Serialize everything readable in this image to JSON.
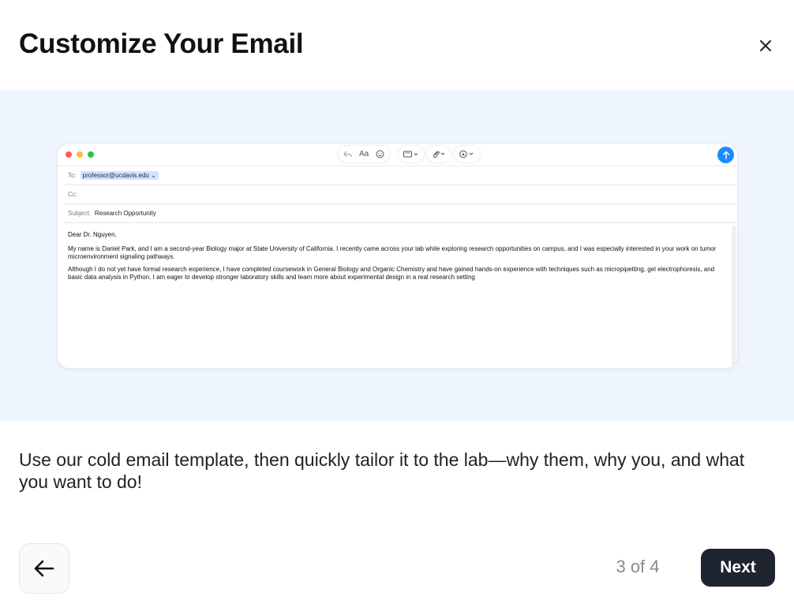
{
  "modal": {
    "title": "Customize Your Email",
    "description": "Use our cold email template, then quickly tailor it to the lab—why them, why you, and what you want to do!"
  },
  "email": {
    "to_label": "To:",
    "to_value": "professor@ucdavis.edu",
    "cc_label": "Cc:",
    "subject_label": "Subject:",
    "subject_value": "Research Opportunity",
    "toolbar": {
      "font_label": "Aa"
    },
    "body": {
      "greeting": "Dear Dr. Nguyen,",
      "paragraph1": "My name is Daniel Park, and I am a second-year Biology major at State University of California. I recently came across your lab while exploring research opportunities on campus, and I was especially interested in your work on tumor microenvironment signaling pathways.",
      "paragraph2": "Although I do not yet have formal research experience, I have completed coursework in General Biology and Organic Chemistry and have gained hands-on experience with techniques such as micropipetting, gel electrophoresis, and basic data analysis in Python. I am eager to develop stronger laboratory skills and learn more about experimental design in a real research setting"
    }
  },
  "footer": {
    "page_indicator": "3 of 4",
    "next_label": "Next"
  },
  "colors": {
    "preview_bg": "#eef5fe",
    "next_bg": "#1e2430",
    "send_blue": "#1a8cff",
    "chip_highlight": "#cfe3ff"
  },
  "icons": {
    "close": "close-icon",
    "back": "arrow-left-icon",
    "send": "arrow-up-icon",
    "reply": "reply-icon",
    "emoji": "emoji-icon",
    "format": "text-box-icon",
    "attach": "paperclip-icon",
    "photo": "photo-browser-icon"
  }
}
